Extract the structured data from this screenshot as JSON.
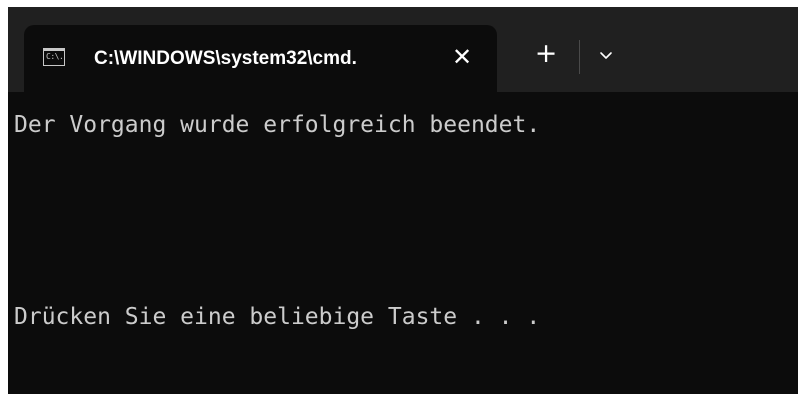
{
  "tab": {
    "icon": "cmd-prompt-icon",
    "icon_text": "C:\\.",
    "title": "C:\\WINDOWS\\system32\\cmd.",
    "close_glyph": "✕"
  },
  "tabstrip": {
    "new_tab_glyph": "+",
    "dropdown_icon": "chevron-down-icon"
  },
  "terminal": {
    "lines": [
      "Der Vorgang wurde erfolgreich beendet.",
      "Drücken Sie eine beliebige Taste . . ."
    ]
  },
  "colors": {
    "terminal_background": "#0c0c0c",
    "tabstrip_background": "#202020",
    "terminal_text": "#cccccc"
  }
}
